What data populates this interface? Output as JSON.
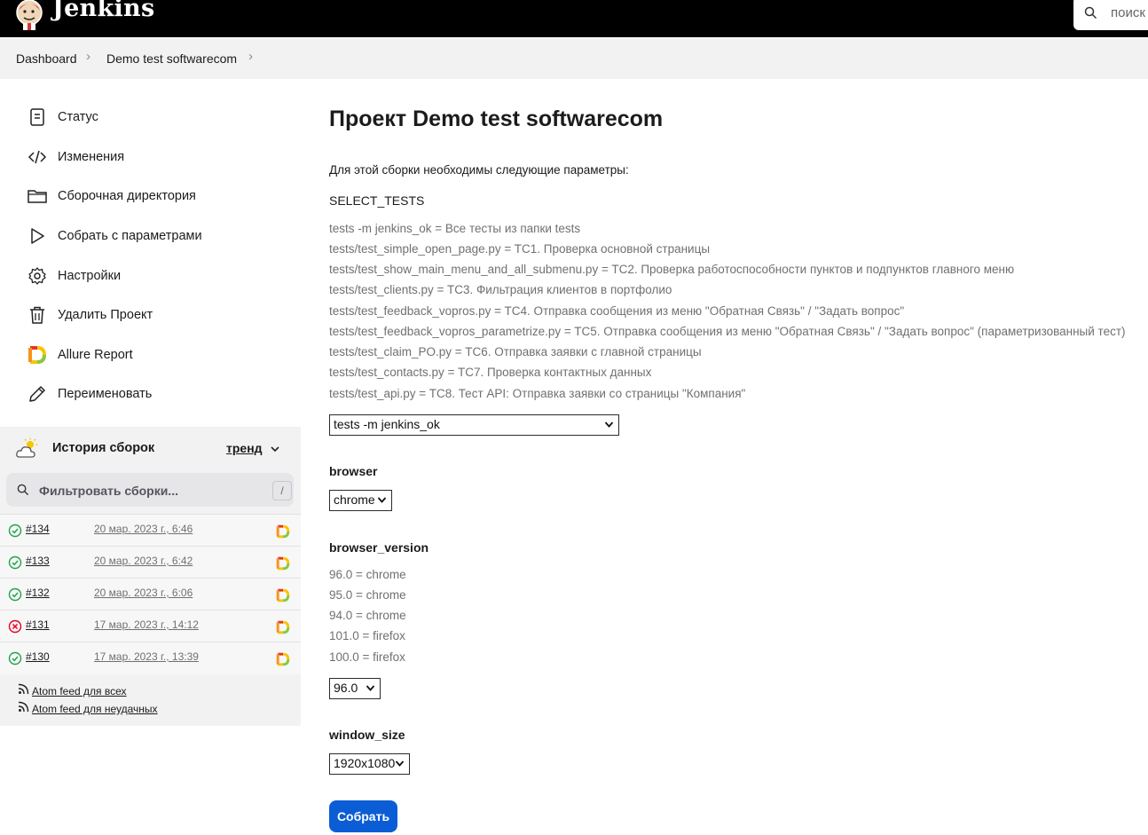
{
  "header": {
    "brand": "Jenkins",
    "search_placeholder": "поиск"
  },
  "breadcrumb": {
    "items": [
      "Dashboard",
      "Demo test softwarecom"
    ]
  },
  "sidebar": {
    "items": [
      {
        "label": "Статус",
        "icon": "document-icon"
      },
      {
        "label": "Изменения",
        "icon": "code-icon"
      },
      {
        "label": "Сборочная директория",
        "icon": "folder-icon"
      },
      {
        "label": "Собрать с параметрами",
        "icon": "play-icon"
      },
      {
        "label": "Настройки",
        "icon": "gear-icon"
      },
      {
        "label": "Удалить Проект",
        "icon": "trash-icon"
      },
      {
        "label": "Allure Report",
        "icon": "allure-icon"
      },
      {
        "label": "Переименовать",
        "icon": "pencil-icon"
      }
    ]
  },
  "history": {
    "title": "История сборок",
    "trend_label": "тренд",
    "filter_placeholder": "Фильтровать сборки...",
    "filter_key": "/",
    "builds": [
      {
        "number": "#134",
        "date": "20 мар. 2023 г., 6:46",
        "status": "success"
      },
      {
        "number": "#133",
        "date": "20 мар. 2023 г., 6:42",
        "status": "success"
      },
      {
        "number": "#132",
        "date": "20 мар. 2023 г., 6:06",
        "status": "success"
      },
      {
        "number": "#131",
        "date": "17 мар. 2023 г., 14:12",
        "status": "failed"
      },
      {
        "number": "#130",
        "date": "17 мар. 2023 г., 13:39",
        "status": "success"
      }
    ],
    "feeds": [
      "Atom feed для всех",
      "Atom feed для неудачных"
    ]
  },
  "main": {
    "title": "Проект Demo test softwarecom",
    "description": "Для этой сборки необходимы следующие параметры:",
    "select_tests": {
      "name": "SELECT_TESTS",
      "options": [
        "tests -m jenkins_ok = Все тесты из папки tests",
        "tests/test_simple_open_page.py = TC1. Проверка основной страницы",
        "tests/test_show_main_menu_and_all_submenu.py = TC2. Проверка работоспособности пунктов и подпунктов главного меню",
        "tests/test_clients.py = TC3. Фильтрация клиентов в портфолио",
        "tests/test_feedback_vopros.py = TC4. Отправка сообщения из меню \"Обратная Связь\" / \"Задать вопрос\"",
        "tests/test_feedback_vopros_parametrize.py = TC5. Отправка сообщения из меню \"Обратная Связь\" / \"Задать вопрос\" (параметризованный тест)",
        "tests/test_claim_PO.py = TC6. Отправка заявки с главной страницы",
        "tests/test_contacts.py = TC7. Проверка контактных данных",
        "tests/test_api.py = TC8. Тест API: Отправка заявки со страницы \"Компания\""
      ],
      "selected": "tests -m jenkins_ok"
    },
    "browser": {
      "name": "browser",
      "selected": "chrome"
    },
    "browser_version": {
      "name": "browser_version",
      "options": [
        "96.0 = chrome",
        "95.0 = chrome",
        "94.0 = chrome",
        "101.0 = firefox",
        "100.0 = firefox"
      ],
      "selected": "96.0"
    },
    "window_size": {
      "name": "window_size",
      "selected": "1920x1080"
    },
    "build_button": "Собрать"
  },
  "colors": {
    "header_bg": "#000000",
    "breadcrumb_bg": "#f2f2f3",
    "primary": "#0b5dd6",
    "success": "#1ea446",
    "failure": "#e6001f"
  }
}
